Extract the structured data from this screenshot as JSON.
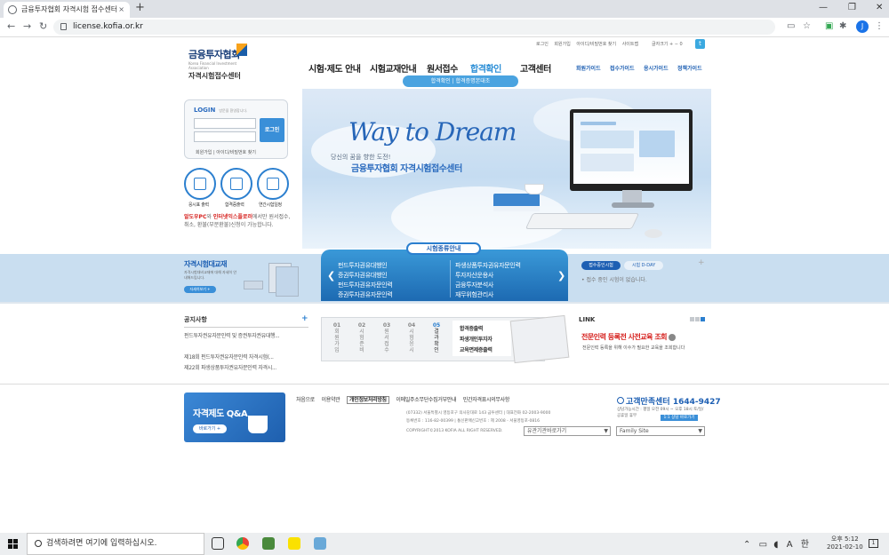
{
  "browser": {
    "tab_title": "금융투자협회 자격시험 접수센터",
    "url": "license.kofia.or.kr",
    "avatar_letter": "J",
    "nav_back": "←",
    "nav_forward": "→",
    "nav_reload": "↻",
    "new_tab": "+",
    "tab_close": "×",
    "min": "—",
    "max": "❐",
    "close": "✕"
  },
  "site": {
    "logo_main": "금융투자협회",
    "logo_en": "Korea Financial Investment Association",
    "logo_sub": "자격시험접수센터",
    "util_links": [
      "로그인",
      "회원가입",
      "아이디/비밀번호 찾기",
      "사이트맵"
    ],
    "font_ctl": "글자크기 + − 0",
    "twitter": "t",
    "gnb": [
      "시험·제도 안내",
      "시험교재안내",
      "원서접수",
      "합격확인",
      "고객센터"
    ],
    "gnb_active": 3,
    "quick_menu": [
      "회원가이드",
      "접수가이드",
      "응시가이드",
      "정책가이드"
    ],
    "subnav": "합격확인 | 합격증명본대조",
    "hero_title": "Way to Dream",
    "hero_slogan1": "당신의 꿈을 향한 도전!",
    "hero_slogan2": "금융투자협회 자격시험접수센터"
  },
  "login": {
    "title": "LOGIN",
    "welcome": "방문을 환영합니다.",
    "button": "로그인",
    "links": "회원가입 | 아이디/비밀번호 찾기"
  },
  "quick_icons": [
    {
      "label": "응시표 출력",
      "icon": "pen-icon"
    },
    {
      "label": "합격증출력",
      "icon": "id-card-icon"
    },
    {
      "label": "연간시험일정",
      "icon": "calendar-icon"
    }
  ],
  "notice_box": {
    "red1": "알도우PC",
    "mid1": "와 ",
    "red2": "인터넷익스플로러",
    "rest": "에서만 원서접수, 취소, 환불(부분환불)신청이 가능합니다."
  },
  "band": {
    "textbook_title": "자격시험대교재",
    "textbook_desc": "자격시험대비교재에 대해 자세히 안내해드립니다.",
    "textbook_btn": "자세히보기 +",
    "panel_title": "시험종류안내",
    "left_items": [
      "펀드투자권유대행인",
      "증권투자권유대행인",
      "펀드투자권유자문인력",
      "증권투자권유자문인력"
    ],
    "right_items": [
      "파생상품투자권유자문인력",
      "투자자산운용사",
      "금융투자분석사",
      "재무위험관리사"
    ],
    "exam_tab1": "접수중인시험",
    "exam_tab2": "시험 D-DAY",
    "exam_msg": "• 접수 중인 시험이 없습니다.",
    "plus": "+",
    "prev": "❮",
    "next": "❯"
  },
  "notice": {
    "title": "공지사항",
    "plus": "+",
    "items": [
      "펀드투자권유자문인력 및 증권투자권유대행...",
      "제18회 펀드투자권유자문인력 자격시험(...",
      "제22회 파생상품투자권유자문인력 자격시..."
    ]
  },
  "steps": {
    "items": [
      {
        "num": "01",
        "label": "회원가입"
      },
      {
        "num": "02",
        "label": "시험준비"
      },
      {
        "num": "03",
        "label": "원서접수"
      },
      {
        "num": "04",
        "label": "시험응시"
      },
      {
        "num": "05",
        "label": "결과확인"
      }
    ],
    "lines": [
      "합격증출력",
      "파생개인투자자",
      "교육면제증출력"
    ]
  },
  "link": {
    "title": "LINK",
    "headline": "전문인력 등록전 사전교육 조회",
    "desc": "전문인력 등록을 위해 이수가 필요한 교육을 조회합니다"
  },
  "footer": {
    "qa_title": "자격제도 Q&A",
    "qa_btn": "바로가기 +",
    "links": [
      "처음으로",
      "이용약관",
      "개인정보처리방침",
      "이메일주소무단수집거부안내",
      "민간자격표시의무사항"
    ],
    "addr1": "(07332) 서울특별시 영등포구 의사당대로 143 금투센터 | 대표전화 02-2003-9000",
    "addr2": "등록번호 : 116-82-00399 | 통신판매신고번호 : 제 2008 - 서울영등포-0816",
    "copyright": "COPYRIGHT©2013 KOFIA ALL RIGHT RESERVED.",
    "select1": "유관기관바로가기",
    "select2": "Family Site",
    "cc_phone": "고객만족센터 1644-9427",
    "cc_hours": "상담가능시간 : 평일 오전 09시 ~ 오후 18시 토/일/공휴일 휴무",
    "cc_btn": "1:1 상담 바로가기"
  },
  "taskbar": {
    "search": "검색하려면 여기에 입력하십시오.",
    "ime": "A",
    "ime2": "한",
    "time": "오후 5:12",
    "date": "2021-02-10",
    "noti": "1"
  }
}
